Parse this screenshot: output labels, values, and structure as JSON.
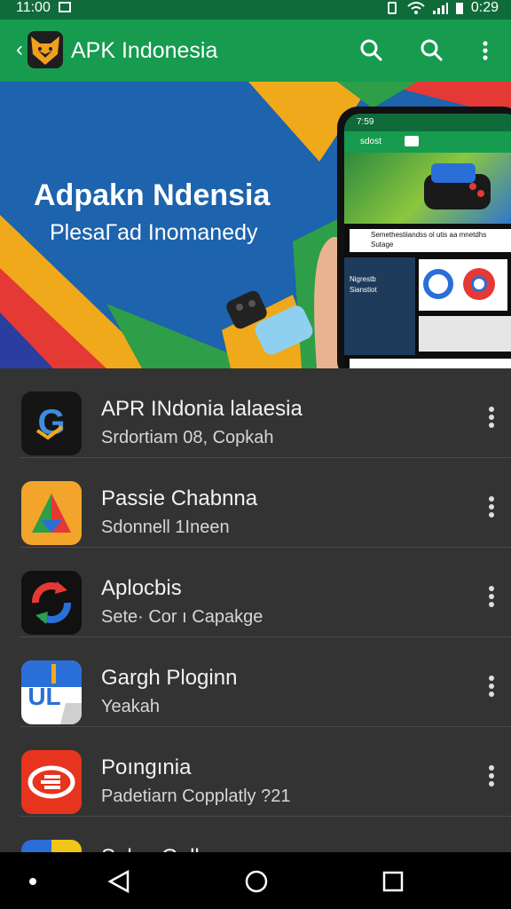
{
  "status_bar": {
    "time": "11:00",
    "battery_text": "0:29"
  },
  "app_bar": {
    "title": "APK Indonesia",
    "icons": [
      "back-arrow-icon",
      "fox-logo-icon",
      "search-icon",
      "search-icon",
      "more-vert-icon"
    ]
  },
  "banner": {
    "headline": "Adpakn Ndensia",
    "subheadline": "PlesaГad Inomanedy",
    "phone_screen": {
      "time": "7:59",
      "top_label": "sdost",
      "card1_line1": "Semethestiiandss ol utis aa mnetdhs",
      "card1_line2": "Sutage",
      "card2_line1": "Nigrestb",
      "card2_line2": "Sianstiot"
    }
  },
  "apps": [
    {
      "title": "APR INdonia lalaesia",
      "subtitle": "Srdortiam 08, Copkah",
      "icon": "g-logo-icon",
      "icon_bg": "#151515"
    },
    {
      "title": "Passie Chabnna",
      "subtitle": "Sdonnell 1Ineen",
      "icon": "drive-triangle-icon",
      "icon_bg": "#f2a52a"
    },
    {
      "title": "Aplocbis",
      "subtitle": "Sete· Cor ı Capakge",
      "icon": "sync-circle-icon",
      "icon_bg": "#111111"
    },
    {
      "title": "Gargh Ploginn",
      "subtitle": "Yeakah",
      "icon": "ul-document-icon",
      "icon_bg": "#ffffff"
    },
    {
      "title": "Poıngınia",
      "subtitle": "Padetiarn Copplatly ?21",
      "icon": "red-badge-icon",
      "icon_bg": "#e6341e"
    },
    {
      "title": "Salee Galla",
      "subtitle": "",
      "icon": "partial-app-icon",
      "icon_bg": "#2a6fd8"
    }
  ],
  "nav_bar": {
    "icons": [
      "dot-icon",
      "back-triangle-icon",
      "home-circle-icon",
      "recents-square-icon"
    ]
  }
}
